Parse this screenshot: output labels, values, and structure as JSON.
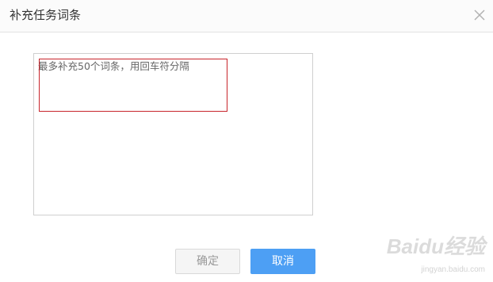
{
  "dialog": {
    "title": "补充任务词条",
    "close_icon": "close-icon"
  },
  "textarea": {
    "placeholder": "最多补充50个词条，用回车符分隔",
    "value": ""
  },
  "buttons": {
    "confirm_label": "确定",
    "cancel_label": "取消"
  },
  "watermark": {
    "brand": "Baidu经验",
    "url": "jingyan.baidu.com"
  },
  "colors": {
    "primary": "#4d9ff4",
    "highlight": "#c8242b",
    "disabled_bg": "#f5f5f5"
  }
}
